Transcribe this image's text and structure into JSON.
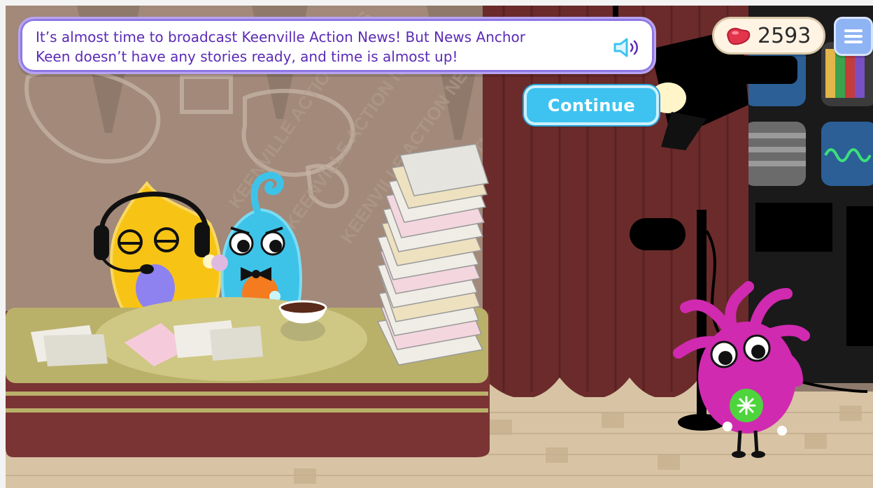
{
  "dialog": {
    "line1": "It’s almost time to broadcast Keenville Action News! But News Anchor",
    "line2": "Keen doesn’t have any stories ready, and time is almost up!",
    "audio_icon": "speaker-icon"
  },
  "continue_label": "Continue",
  "hud": {
    "bean_count": "2593",
    "bean_icon": "jellybean-icon",
    "menu_icon": "hamburger-icon"
  },
  "backdrop_text": "KEENVILLE ACTION NEWS",
  "colors": {
    "dialog_text": "#5b2bb6",
    "continue_bg": "#3ec3f0",
    "menu_bg": "#8fb4f4",
    "bean": "#e2344a",
    "curtain": "#6b2b2b",
    "desk_top": "#b9b16a",
    "desk_body": "#7a3434",
    "floor": "#d8c4a4"
  },
  "characters": [
    "yellow-anchor-character",
    "blue-bowtie-character",
    "pink-character"
  ]
}
